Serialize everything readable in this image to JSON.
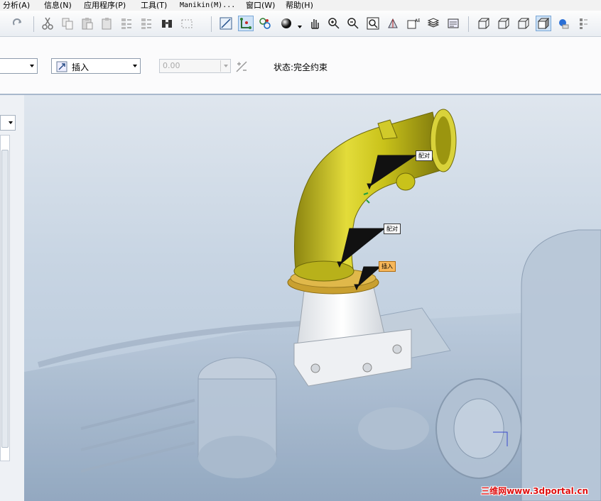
{
  "menu": {
    "items": [
      "分析(A)",
      "信息(N)",
      "应用程序(P)",
      "工具(T)",
      "Manikin(M)...",
      "窗口(W)",
      "帮助(H)"
    ]
  },
  "toolbar": {
    "buttons": [
      "redo-icon",
      "cut-icon",
      "copy-icon",
      "paste-icon",
      "paste-special-icon",
      "regenerate-icon",
      "regen-manager-icon",
      "find-icon",
      "select-box-icon",
      "sketch-view-icon",
      "datum-display-icon",
      "spin-center-icon",
      "shading-icon",
      "pan-icon",
      "zoom-in-icon",
      "zoom-out-icon",
      "refit-icon",
      "reorient-icon",
      "saved-views-icon",
      "layers-icon",
      "wireframe-icon",
      "hidden-line-icon",
      "no-hidden-icon",
      "shaded-icon",
      "appearance-icon",
      "more-icon"
    ]
  },
  "dashboard": {
    "constraint_type": "插入",
    "offset_value": "0.00",
    "status": "状态:完全约束"
  },
  "viewport": {
    "labels": {
      "align1": "配对",
      "align2": "配对",
      "insert": "插入"
    },
    "colors": {
      "pipe": "#c9c21a",
      "flange": "#e0a93a",
      "background": "#c8d5e3"
    }
  },
  "watermark": "三维网www.3dportal.cn"
}
